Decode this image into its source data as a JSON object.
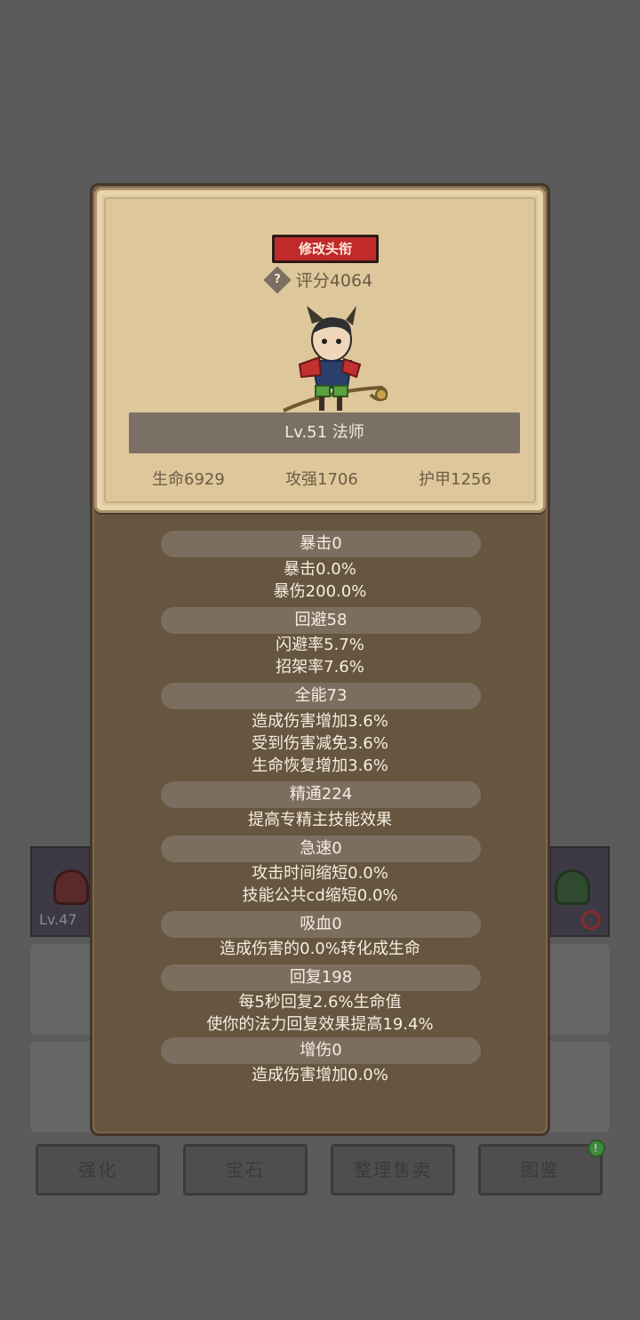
{
  "background": {
    "left_slot_level": "Lv.47",
    "buttons": [
      "强化",
      "宝石",
      "整理售卖",
      "图鉴"
    ],
    "notify_badge": "!"
  },
  "profile": {
    "edit_title_label": "修改头衔",
    "help_glyph": "?",
    "score_text": "评分4064",
    "level_class": "Lv.51 法师",
    "stats": {
      "life": "生命6929",
      "attack": "攻强1706",
      "armor": "护甲1256"
    }
  },
  "attributes": [
    {
      "header": "暴击0",
      "lines": [
        "暴击0.0%",
        "暴伤200.0%"
      ]
    },
    {
      "header": "回避58",
      "lines": [
        "闪避率5.7%",
        "招架率7.6%"
      ]
    },
    {
      "header": "全能73",
      "lines": [
        "造成伤害增加3.6%",
        "受到伤害减免3.6%",
        "生命恢复增加3.6%"
      ]
    },
    {
      "header": "精通224",
      "lines": [
        "提高专精主技能效果"
      ]
    },
    {
      "header": "急速0",
      "lines": [
        "攻击时间缩短0.0%",
        "技能公共cd缩短0.0%"
      ]
    },
    {
      "header": "吸血0",
      "lines": [
        "造成伤害的0.0%转化成生命"
      ]
    },
    {
      "header": "回复198",
      "lines": [
        "每5秒回复2.6%生命值",
        "使你的法力回复效果提高19.4%"
      ]
    },
    {
      "header": "增伤0",
      "lines": [
        "造成伤害增加0.0%"
      ]
    }
  ]
}
